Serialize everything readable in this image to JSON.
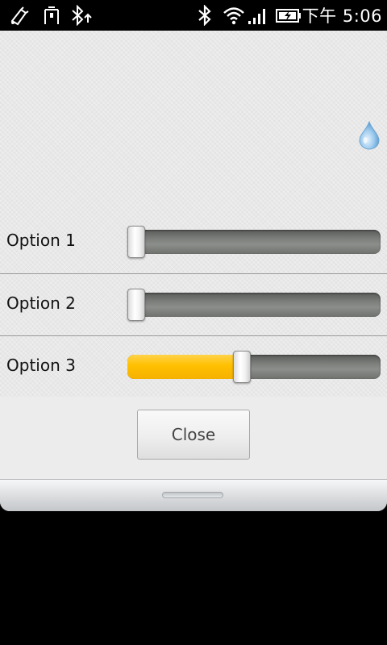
{
  "status_bar": {
    "time": "下午 5:06",
    "left_icons": [
      "usb-debug-icon",
      "usb-connection-icon",
      "bluetooth-tethering-icon"
    ],
    "right_icons": [
      "bluetooth-icon",
      "wifi-icon",
      "signal-icon",
      "battery-charging-icon"
    ]
  },
  "dialog": {
    "decor_icon": "water-drop-icon",
    "options": [
      {
        "label": "Option 1",
        "value": 0.0
      },
      {
        "label": "Option 2",
        "value": 0.0
      },
      {
        "label": "Option 3",
        "value": 0.45
      }
    ],
    "close_label": "Close"
  },
  "colors": {
    "slider_fill": "#ffc000",
    "slider_track": "#7b7d7a",
    "status_bar_bg": "#000000"
  }
}
